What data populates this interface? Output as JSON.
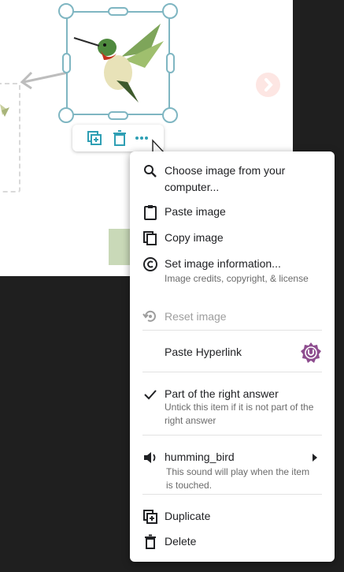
{
  "colors": {
    "selection": "#7fb6c2",
    "toolbar_icon": "#2f9fb4",
    "badge": "#8e4d8f",
    "text": "#202124",
    "subtext": "#6b6b6b",
    "disabled": "#9e9e9e"
  },
  "toolbar": {
    "icons": [
      "duplicate-icon",
      "trash-icon",
      "more-horiz-icon"
    ]
  },
  "menu": {
    "choose_image": "Choose image from your computer...",
    "paste_image": "Paste image",
    "copy_image": "Copy image",
    "set_info": "Set image information...",
    "set_info_sub": "Image credits, copyright, & license",
    "reset_image": "Reset image",
    "paste_hyperlink": "Paste Hyperlink",
    "right_answer": "Part of the right answer",
    "right_answer_sub": "Untick this item if it is not part of the right answer",
    "sound_name": "humming_bird",
    "sound_sub": "This sound will play when the item is touched.",
    "duplicate": "Duplicate",
    "delete": "Delete"
  }
}
